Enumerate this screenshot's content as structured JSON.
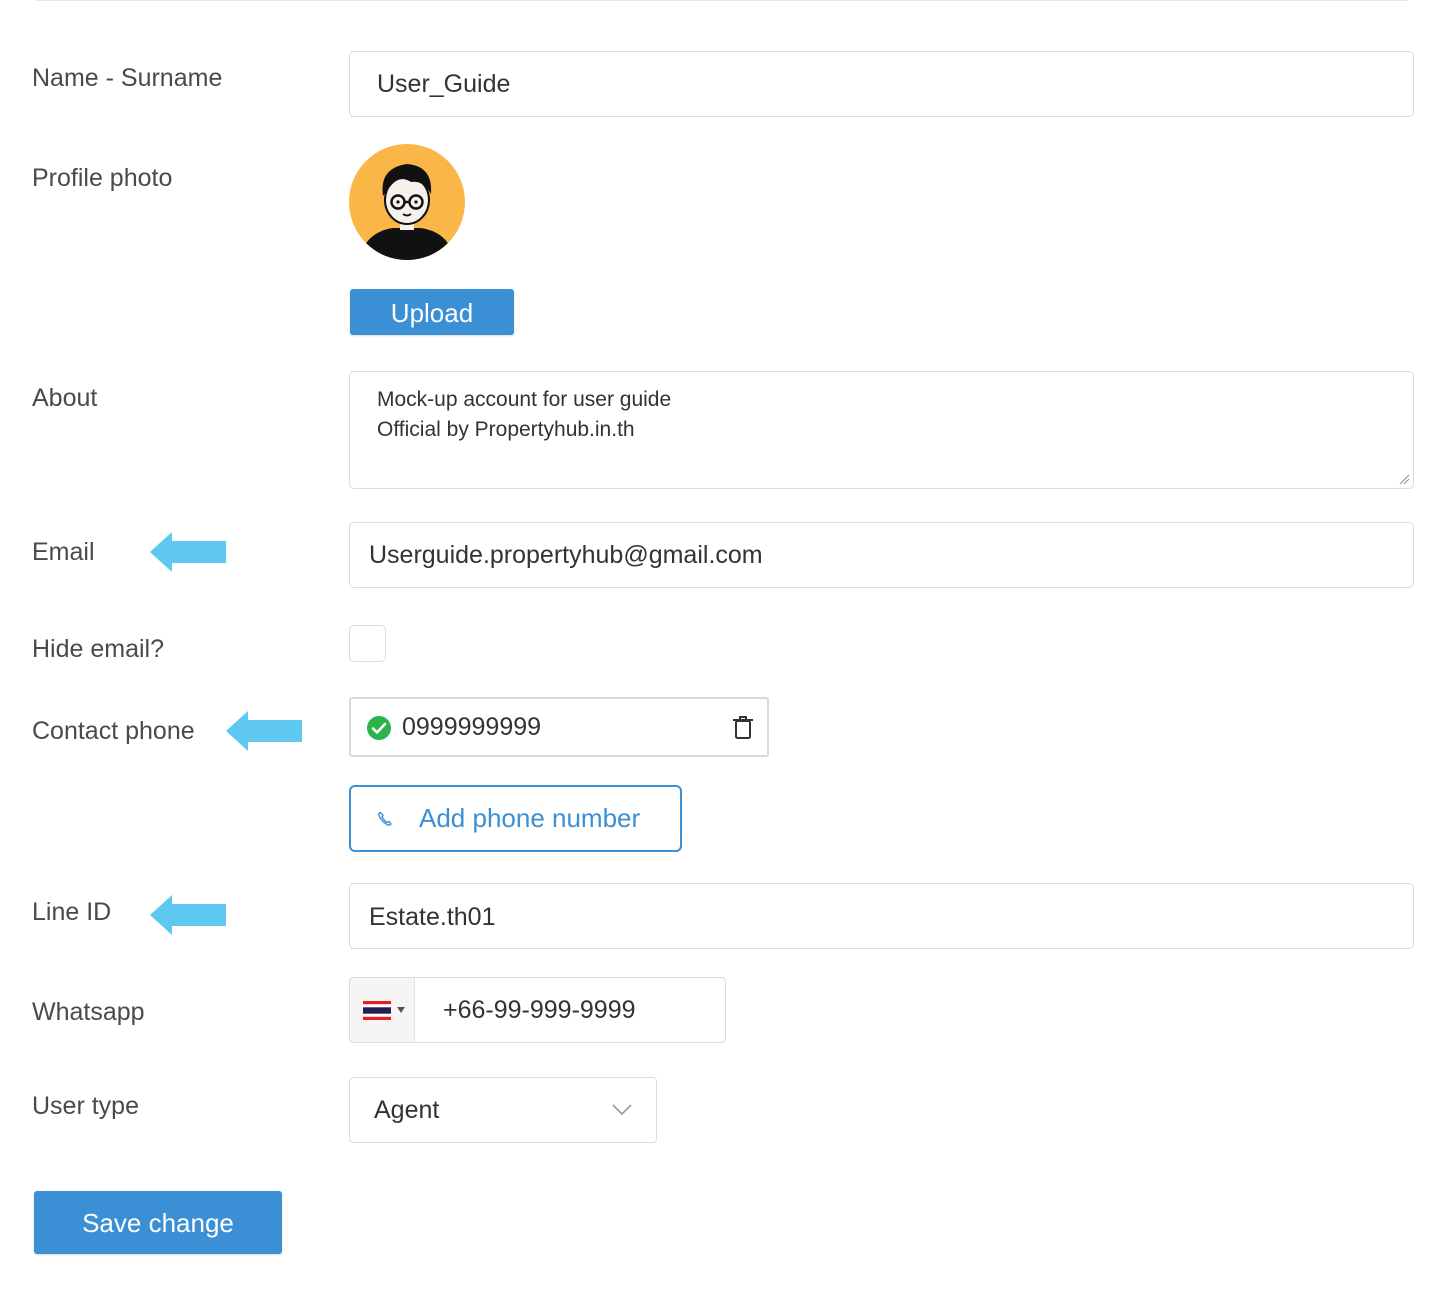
{
  "form": {
    "name_label": "Name - Surname",
    "name_value": "User_Guide",
    "photo_label": "Profile photo",
    "upload_label": "Upload",
    "about_label": "About",
    "about_line1": "Mock-up account for user guide",
    "about_line2": "Official by Propertyhub.in.th",
    "email_label": "Email",
    "email_value": "Userguide.propertyhub@gmail.com",
    "hide_email_label": "Hide email?",
    "hide_email_checked": false,
    "contact_phone_label": "Contact phone",
    "phone_value": "0999999999",
    "phone_verified": true,
    "add_phone_label": "Add phone number",
    "line_label": "Line ID",
    "line_value": "Estate.th01",
    "whatsapp_label": "Whatsapp",
    "whatsapp_value": "+66-99-999-9999",
    "whatsapp_country": "Thailand",
    "user_type_label": "User type",
    "user_type_value": "Agent",
    "save_label": "Save change"
  },
  "colors": {
    "primary": "#3a8fd5",
    "arrow": "#5ec8f0",
    "verified": "#2db34a",
    "avatar_bg": "#fbb648"
  }
}
